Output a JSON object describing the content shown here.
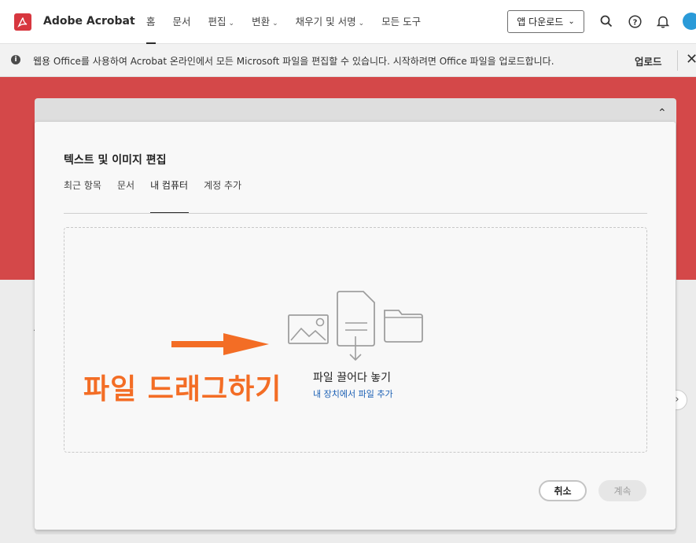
{
  "app": {
    "name": "Adobe Acrobat"
  },
  "nav": {
    "items": [
      {
        "label": "홈",
        "chevron": false,
        "active": true
      },
      {
        "label": "문서",
        "chevron": false,
        "active": false
      },
      {
        "label": "편집",
        "chevron": true,
        "active": false
      },
      {
        "label": "변환",
        "chevron": true,
        "active": false
      },
      {
        "label": "채우기 및 서명",
        "chevron": true,
        "active": false
      },
      {
        "label": "모든 도구",
        "chevron": false,
        "active": false
      }
    ],
    "app_download": "앱 다운로드"
  },
  "toolbar_icons": [
    "search-icon",
    "help-icon",
    "bell-icon"
  ],
  "banner": {
    "text": "웹용 Office를 사용하여 Acrobat 온라인에서 모든 Microsoft 파일을 편집할 수 있습니다. 시작하려면 Office 파일을 업로드합니다.",
    "upload": "업로드",
    "close": "✕"
  },
  "dialog": {
    "title": "텍스트 및 이미지 편집",
    "tabs": [
      "최근 항목",
      "문서",
      "내 컴퓨터",
      "계정 추가"
    ],
    "active_tab": 2,
    "dropzone": {
      "label": "파일 끌어다 놓기",
      "link": "내 장치에서 파일 추가"
    },
    "annotation": "파일 드래그하기",
    "buttons": {
      "cancel": "취소",
      "next": "계속"
    }
  },
  "colors": {
    "hero": "#d44849",
    "annotation": "#f36d25",
    "link": "#1a5fb4"
  }
}
